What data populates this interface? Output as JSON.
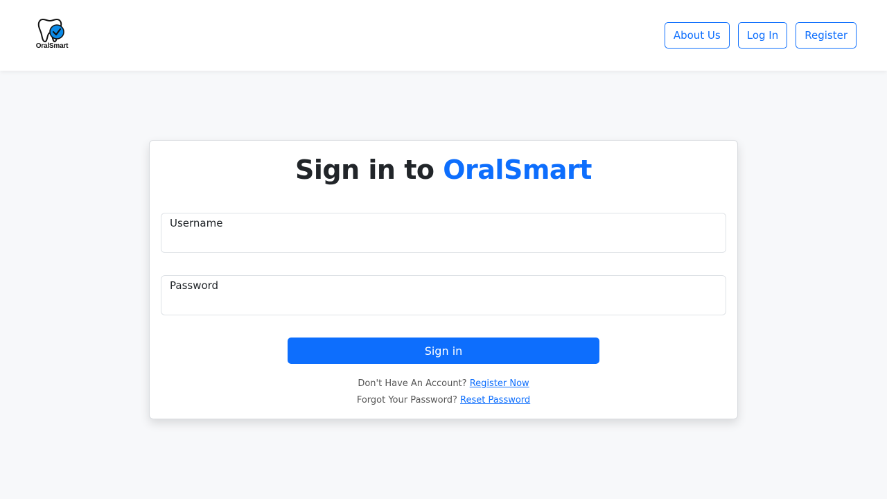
{
  "header": {
    "logo_text": "OralSmart",
    "nav": {
      "about_label": "About Us",
      "login_label": "Log In",
      "register_label": "Register"
    }
  },
  "login_card": {
    "title_prefix": "Sign in to",
    "title_brand": "OralSmart",
    "username_label": "Username",
    "username_value": "",
    "password_label": "Password",
    "password_value": "",
    "submit_label": "Sign in",
    "register_prompt": "Don't Have An Account?",
    "register_link": "Register Now",
    "forgot_prompt": "Forgot Your Password?",
    "reset_link": "Reset Password"
  },
  "colors": {
    "accent": "#0d6efd",
    "page_bg": "#f7f8fa",
    "header_bg": "#ffffff"
  },
  "icons": {
    "logo": "tooth-check-icon"
  }
}
